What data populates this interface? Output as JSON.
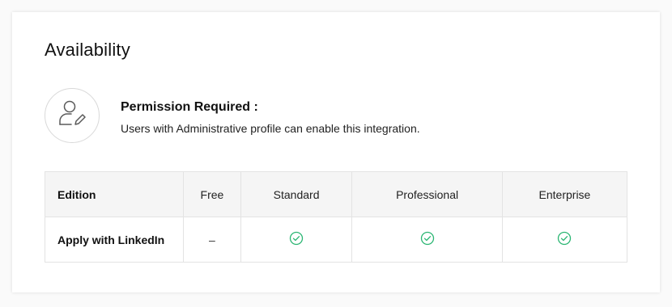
{
  "section": {
    "title": "Availability"
  },
  "permission": {
    "icon": "user-edit-icon",
    "title": "Permission Required :",
    "description": "Users with Administrative profile can enable this integration."
  },
  "table": {
    "header": {
      "label": "Edition",
      "columns": [
        "Free",
        "Standard",
        "Professional",
        "Enterprise"
      ]
    },
    "rows": [
      {
        "label": "Apply with LinkedIn",
        "values": [
          "–",
          "check",
          "check",
          "check"
        ]
      }
    ]
  },
  "colors": {
    "check_green": "#2bb673",
    "header_bg": "#f5f5f5",
    "border": "#e3e3e3"
  }
}
